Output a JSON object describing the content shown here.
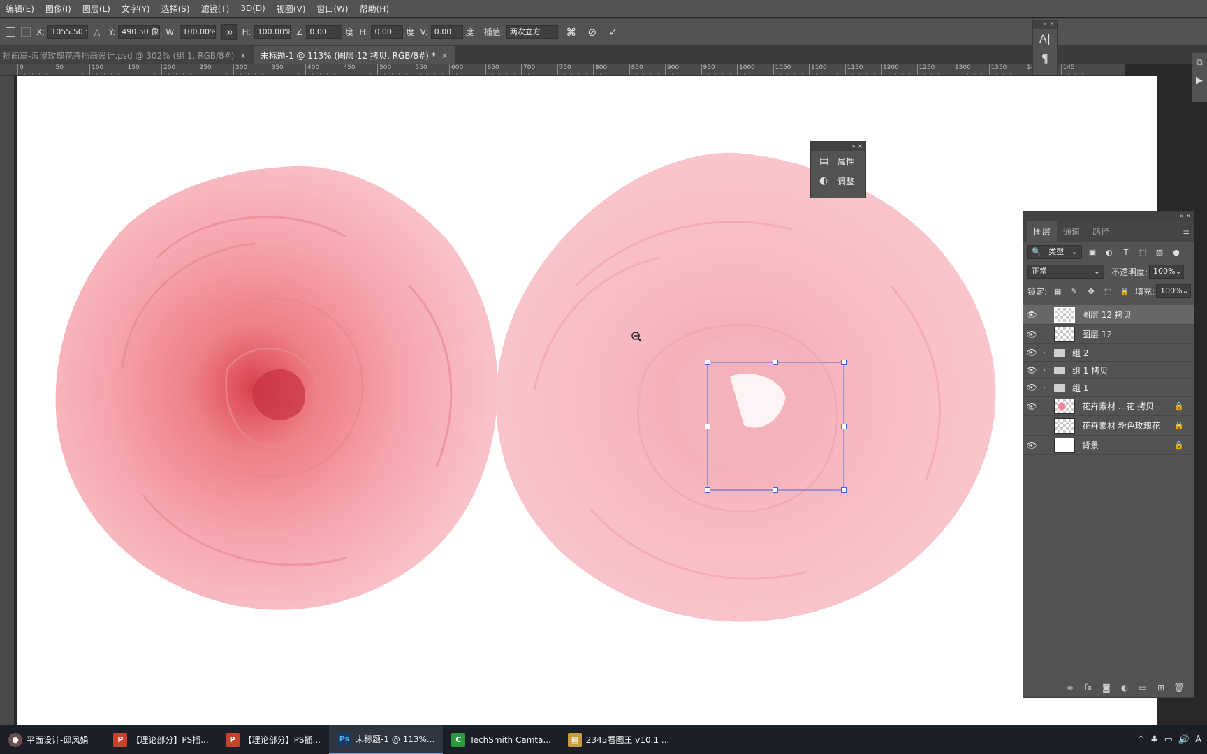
{
  "menu": [
    "编辑(E)",
    "图像(I)",
    "图层(L)",
    "文字(Y)",
    "选择(S)",
    "滤镜(T)",
    "3D(D)",
    "视图(V)",
    "窗口(W)",
    "帮助(H)"
  ],
  "options": {
    "x_label": "X:",
    "x_value": "1055.50 像",
    "y_label": "Y:",
    "y_value": "490.50 像素",
    "w_label": "W:",
    "w_value": "100.00%",
    "h_label": "H:",
    "h_value": "100.00%",
    "angle_value": "0.00",
    "angle_unit": "度",
    "hskew_label": "H:",
    "hskew_value": "0.00",
    "hskew_unit": "度",
    "vskew_label": "V:",
    "vskew_value": "0.00",
    "vskew_unit": "度",
    "interp_label": "插值:",
    "interp_value": "两次立方"
  },
  "tabs": [
    {
      "label": "插画篇-浪漫玫瑰花卉插画设计.psd @ 302% (组 1, RGB/8#)",
      "close": "×"
    },
    {
      "label": "未标题-1 @ 113% (图层 12 拷贝, RGB/8#) *",
      "close": "×"
    }
  ],
  "ruler_ticks": [
    "0",
    "50",
    "100",
    "150",
    "200",
    "250",
    "300",
    "350",
    "400",
    "450",
    "500",
    "550",
    "600",
    "650",
    "700",
    "750",
    "800",
    "850",
    "900",
    "950",
    "1000",
    "1050",
    "1100",
    "1150",
    "1200",
    "1250",
    "1300",
    "1350",
    "1400",
    "145"
  ],
  "prop_panel": {
    "items": [
      {
        "icon": "properties-icon",
        "label": "属性"
      },
      {
        "icon": "adjustments-icon",
        "label": "调整"
      }
    ]
  },
  "layers_panel": {
    "tabs": [
      "图层",
      "通道",
      "路径"
    ],
    "filter_kind": "类型",
    "blend_mode": "正常",
    "opacity_label": "不透明度:",
    "opacity_value": "100%",
    "lock_label": "锁定:",
    "fill_label": "填充:",
    "fill_value": "100%",
    "layers": [
      {
        "name": "图层 12 拷贝",
        "type": "pixel",
        "visible": true,
        "selected": true
      },
      {
        "name": "图层 12",
        "type": "pixel",
        "visible": true
      },
      {
        "name": "组 2",
        "type": "group",
        "visible": true
      },
      {
        "name": "组 1 拷贝",
        "type": "group",
        "visible": true
      },
      {
        "name": "组 1",
        "type": "group",
        "visible": true
      },
      {
        "name": "花卉素材 ...花 拷贝",
        "type": "smart",
        "visible": true,
        "locked": true
      },
      {
        "name": "花卉素材 粉色玫瑰花",
        "type": "smart",
        "visible": false,
        "locked": true
      },
      {
        "name": "背景",
        "type": "background",
        "visible": true,
        "locked": true
      }
    ]
  },
  "taskbar": [
    {
      "label": "平面设计-邱凤娟",
      "icon": "avatar-icon",
      "color": "#6b4f4f"
    },
    {
      "label": "【理论部分】PS插...",
      "icon": "powerpoint-icon",
      "color": "#c7422a"
    },
    {
      "label": "【理论部分】PS插...",
      "icon": "powerpoint-icon",
      "color": "#c7422a"
    },
    {
      "label": "未标题-1 @ 113%...",
      "icon": "photoshop-icon",
      "color": "#1c3c5e",
      "active": true
    },
    {
      "label": "TechSmith Camta...",
      "icon": "camtasia-icon",
      "color": "#2c9a3e"
    },
    {
      "label": "2345看图王 v10.1 ...",
      "icon": "image-viewer-icon",
      "color": "#c89b3c"
    }
  ],
  "colors": {
    "ui_bg": "#535353",
    "canvas": "#ffffff",
    "rose_light": "#f7b8c0",
    "rose_deep": "#e8707a",
    "selection": "#4a6bd6"
  }
}
